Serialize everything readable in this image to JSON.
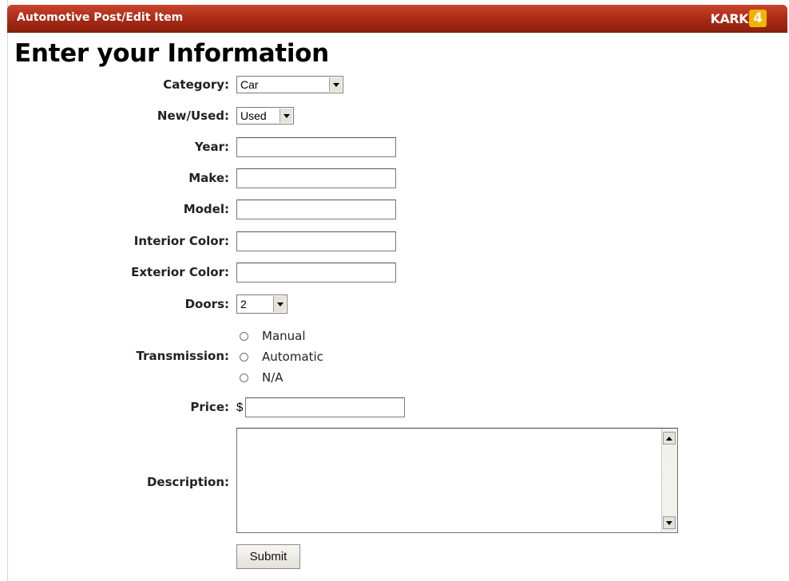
{
  "window": {
    "title": "Automotive Post/Edit Item",
    "logo": {
      "text": "KARK",
      "digit": "4"
    }
  },
  "page": {
    "heading": "Enter your Information"
  },
  "form": {
    "category": {
      "label": "Category:",
      "value": "Car"
    },
    "new_used": {
      "label": "New/Used:",
      "value": "Used"
    },
    "year": {
      "label": "Year:",
      "value": ""
    },
    "make": {
      "label": "Make:",
      "value": ""
    },
    "model": {
      "label": "Model:",
      "value": ""
    },
    "interior_color": {
      "label": "Interior Color:",
      "value": ""
    },
    "exterior_color": {
      "label": "Exterior Color:",
      "value": ""
    },
    "doors": {
      "label": "Doors:",
      "value": "2"
    },
    "transmission": {
      "label": "Transmission:",
      "options": [
        "Manual",
        "Automatic",
        "N/A"
      ]
    },
    "price": {
      "label": "Price:",
      "currency_symbol": "$",
      "value": ""
    },
    "description": {
      "label": "Description:",
      "value": ""
    },
    "submit_label": "Submit"
  },
  "colors": {
    "titlebar": "#a82a15",
    "logo_accent": "#f1b300"
  }
}
